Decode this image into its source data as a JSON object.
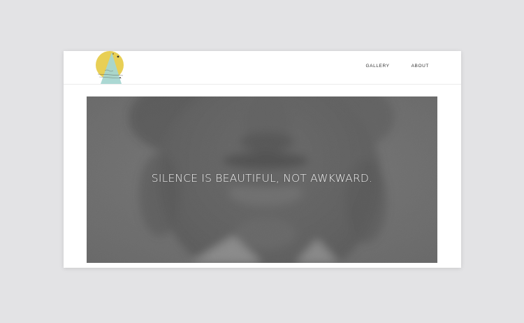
{
  "nav": {
    "items": [
      "GALLERY",
      "ABOUT"
    ]
  },
  "hero": {
    "tagline": "SILENCE IS BEAUTIFUL, NOT AWKWARD."
  },
  "colors": {
    "background": "#e3e3e5",
    "logo_sun": "#e8cf55",
    "logo_triangle": "#a7d6d1",
    "hero_text": "#f2f2f2"
  },
  "icons": {
    "logo": "sun-triangle-logo"
  }
}
